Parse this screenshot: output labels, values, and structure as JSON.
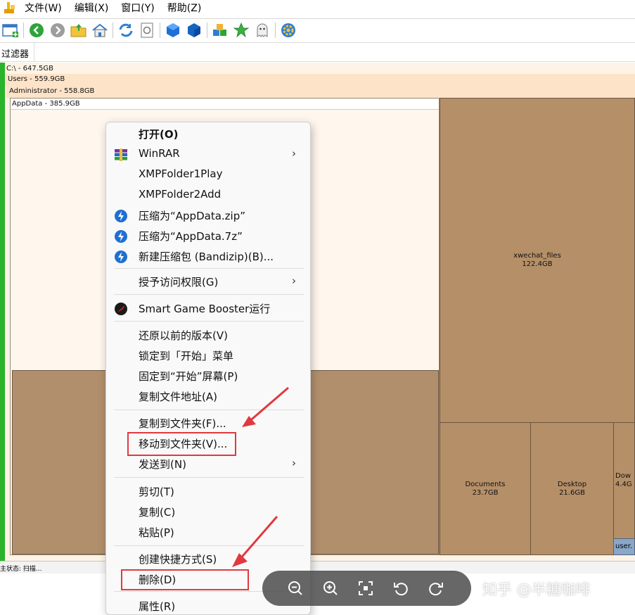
{
  "menubar": {
    "items": [
      "文件(W)",
      "编辑(X)",
      "窗口(Y)",
      "帮助(Z)"
    ]
  },
  "toolbar": {
    "icons": [
      "new-window-icon",
      "back-icon",
      "forward-icon",
      "open-folder-icon",
      "home-icon",
      "refresh-icon",
      "reload-page-icon",
      "blue-cube-icon",
      "blue-shield-icon",
      "colored-blocks-icon",
      "star-icon",
      "ghost-icon",
      "gear-icon"
    ]
  },
  "filter": {
    "label": "过滤器"
  },
  "treemap": {
    "root_label": "C:\\ - 647.5GB",
    "users_label": "Users - 559.9GB",
    "admin_label": "Administrator - 558.8GB",
    "appdata_label": "AppData - 385.9GB",
    "blocks": [
      {
        "name": "xwechat_files",
        "size": "122.4GB"
      },
      {
        "name": "Documents",
        "size": "23.7GB"
      },
      {
        "name": "Desktop",
        "size": "21.6GB"
      },
      {
        "name": "Dow",
        "size": "4.4G"
      }
    ],
    "small_block": "user."
  },
  "status": {
    "text": "主状态: 扫描..."
  },
  "context_menu": {
    "items": [
      {
        "label": "打开(O)",
        "bold": true
      },
      {
        "label": "WinRAR",
        "submenu": true,
        "icon": "winrar-icon"
      },
      {
        "label": "XMPFolder1Play"
      },
      {
        "label": "XMPFolder2Add"
      },
      {
        "label": "压缩为“AppData.zip”",
        "icon": "bandizip-icon"
      },
      {
        "label": "压缩为“AppData.7z”",
        "icon": "bandizip-icon"
      },
      {
        "label": "新建压缩包 (Bandizip)(B)...",
        "icon": "bandizip-icon"
      },
      {
        "label": "授予访问权限(G)",
        "submenu": true
      },
      {
        "label": "Smart Game Booster运行",
        "icon": "smart-game-booster-icon"
      },
      {
        "label": "还原以前的版本(V)"
      },
      {
        "label": "锁定到「开始」菜单"
      },
      {
        "label": "固定到“开始”屏幕(P)"
      },
      {
        "label": "复制文件地址(A)"
      },
      {
        "label": "复制到文件夹(F)..."
      },
      {
        "label": "移动到文件夹(V)..."
      },
      {
        "label": "发送到(N)",
        "submenu": true
      },
      {
        "label": "剪切(T)"
      },
      {
        "label": "复制(C)"
      },
      {
        "label": "粘贴(P)"
      },
      {
        "label": "创建快捷方式(S)"
      },
      {
        "label": "删除(D)"
      },
      {
        "label": "属性(R)"
      }
    ],
    "submenu_arrow": "›"
  },
  "viewer": {
    "buttons": [
      "zoom-out-icon",
      "zoom-in-icon",
      "fit-screen-icon",
      "rotate-left-icon",
      "rotate-right-icon"
    ]
  },
  "watermark": "知乎 @半糖咖啡",
  "colors": {
    "highlight_red": "#e0393e",
    "treemap_brown": "#b58f68",
    "green_bar": "#2bb32b"
  }
}
